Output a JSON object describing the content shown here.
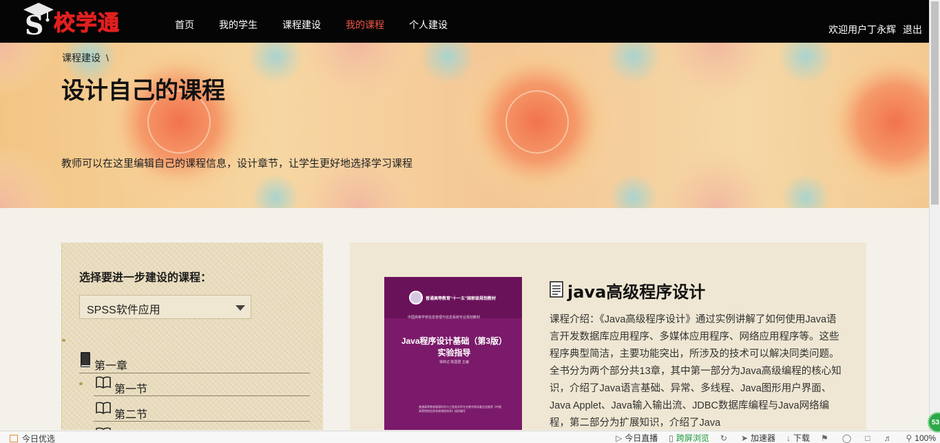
{
  "brand": {
    "name": "校学通",
    "mark": "S"
  },
  "nav": {
    "items": [
      {
        "label": "首页",
        "active": false
      },
      {
        "label": "我的学生",
        "active": false
      },
      {
        "label": "课程建设",
        "active": false
      },
      {
        "label": "我的课程",
        "active": true
      },
      {
        "label": "个人建设",
        "active": false
      }
    ],
    "welcome": "欢迎用户丁永辉",
    "logout": "退出"
  },
  "hero": {
    "breadcrumb": "课程建设",
    "breadcrumb_sep": "\\",
    "title": "设计自己的课程",
    "description": "教师可以在这里编辑自己的课程信息，设计章节，让学生更好地选择学习课程"
  },
  "course_picker": {
    "label": "选择要进一步建设的课程：",
    "selected": "SPSS软件应用",
    "chapters": [
      {
        "label": "第一章",
        "icon": "book-closed-icon",
        "sections": [
          "第一节",
          "第二节"
        ]
      }
    ]
  },
  "course": {
    "title": "java高级程序设计",
    "icon": "document-icon",
    "description": "课程介绍：《Java高级程序设计》通过实例讲解了如何使用Java语言开发数据库应用程序、多媒体应用程序、网络应用程序等。这些程序典型简洁，主要功能突出，所涉及的技术可以解决同类问题。全书分为两个部分共13章，其中第一部分为Java高级编程的核心知识，介绍了Java语言基础、异常、多线程、Java图形用户界面、Java Applet、Java输入输出流、JDBC数据库编程与Java网络编程，第二部分为扩展知识，介绍了Java",
    "cover": {
      "series": "普通高等教育“十一五”国家级规划教材",
      "subseries": "中国高等学校信息管理与信息系统专业规划教材",
      "title_line1": "Java程序设计基础（第3版）",
      "title_line2": "实验指导",
      "authors": "邹林达 陈国君 主编",
      "fine_print": "普通高等教育管理科学与工程类学科专业教学指导委员会推荐《中国高等院校信息系统课程体系》组织编写"
    }
  },
  "statusbar": {
    "left": "今日优选",
    "items": [
      {
        "label": "今日直播",
        "icon": "play-icon"
      },
      {
        "label": "跨屏浏览",
        "icon": "phone-icon"
      },
      {
        "label": "",
        "icon": "refresh-icon"
      },
      {
        "label": "加速器",
        "icon": "rocket-icon"
      },
      {
        "label": "下载",
        "icon": "download-icon"
      },
      {
        "label": "",
        "icon": "flag-icon"
      },
      {
        "label": "",
        "icon": "ie-icon"
      },
      {
        "label": "",
        "icon": "window-icon"
      },
      {
        "label": "",
        "icon": "speaker-icon"
      },
      {
        "label": "100%",
        "icon": "zoom-icon"
      }
    ],
    "badge": "53"
  },
  "colors": {
    "nav_active": "#f05545",
    "brand_red": "#e21f1f",
    "book_purple": "#7b1a6a"
  }
}
